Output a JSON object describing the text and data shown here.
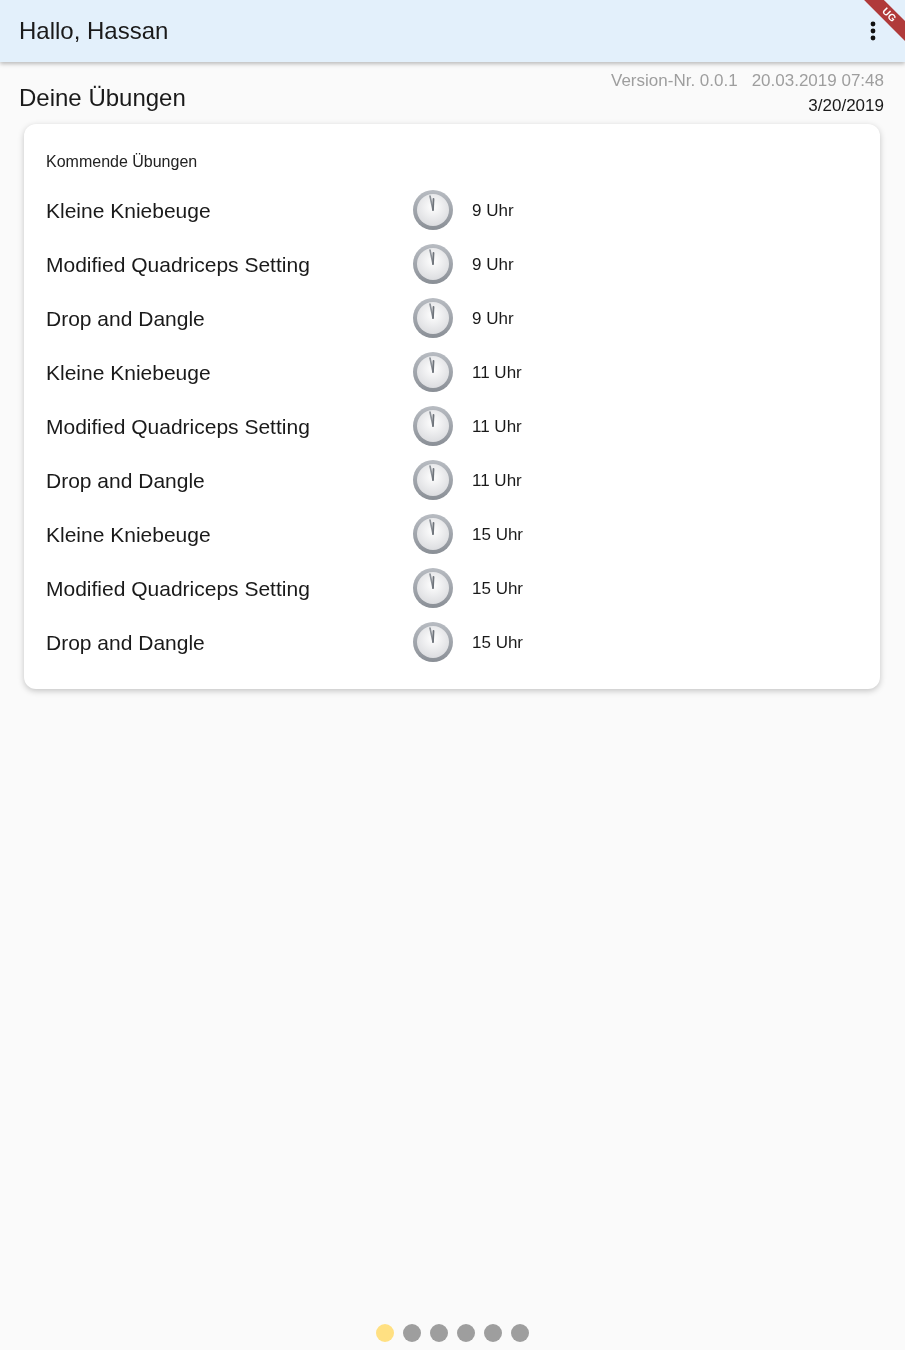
{
  "app_bar": {
    "title": "Hallo, Hassan",
    "debug_banner": "UG"
  },
  "header": {
    "version": "Version-Nr. 0.0.1",
    "timestamp": "20.03.2019 07:48",
    "title": "Deine Übungen",
    "date": "3/20/2019"
  },
  "card": {
    "title": "Kommende Übungen",
    "rows": [
      {
        "name": "Kleine Kniebeuge",
        "time": "9 Uhr"
      },
      {
        "name": "Modified Quadriceps Setting",
        "time": "9 Uhr"
      },
      {
        "name": "Drop and Dangle",
        "time": "9 Uhr"
      },
      {
        "name": "Kleine Kniebeuge",
        "time": "11 Uhr"
      },
      {
        "name": "Modified Quadriceps Setting",
        "time": "11 Uhr"
      },
      {
        "name": "Drop and Dangle",
        "time": "11 Uhr"
      },
      {
        "name": "Kleine Kniebeuge",
        "time": "15 Uhr"
      },
      {
        "name": "Modified Quadriceps Setting",
        "time": "15 Uhr"
      },
      {
        "name": "Drop and Dangle",
        "time": "15 Uhr"
      }
    ]
  },
  "page_indicator": [
    {
      "selected": true
    },
    {
      "selected": false
    },
    {
      "selected": false
    },
    {
      "selected": false
    },
    {
      "selected": false
    },
    {
      "selected": false
    }
  ]
}
